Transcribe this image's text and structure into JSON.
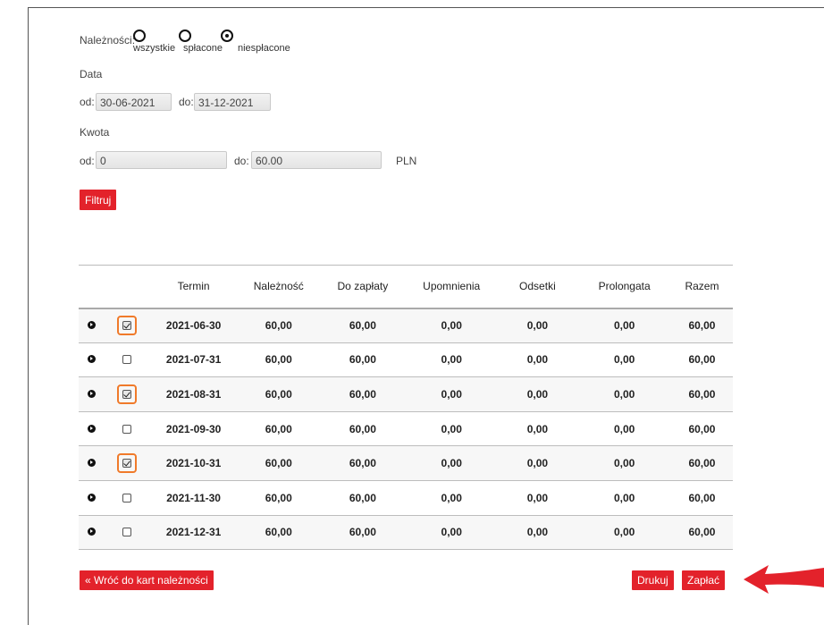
{
  "filters": {
    "dues_label": "Należności:",
    "radio_options": [
      {
        "label": "wszystkie",
        "checked": false
      },
      {
        "label": "spłacone",
        "checked": false
      },
      {
        "label": "niespłacone",
        "checked": true
      }
    ],
    "date_label": "Data",
    "date_from_label": "od:",
    "date_from_value": "30-06-2021",
    "date_to_label": "do:",
    "date_to_value": "31-12-2021",
    "amount_label": "Kwota",
    "amount_from_label": "od:",
    "amount_from_value": "0",
    "amount_to_label": "do:",
    "amount_to_value": "60.00",
    "currency": "PLN",
    "filter_button": "Filtruj"
  },
  "table": {
    "columns": [
      "",
      "",
      "Termin",
      "Należność",
      "Do zapłaty",
      "Upomnienia",
      "Odsetki",
      "Prolongata",
      "Razem"
    ],
    "rows": [
      {
        "checked": true,
        "cells": [
          "2021-06-30",
          "60,00",
          "60,00",
          "0,00",
          "0,00",
          "0,00",
          "60,00"
        ]
      },
      {
        "checked": false,
        "cells": [
          "2021-07-31",
          "60,00",
          "60,00",
          "0,00",
          "0,00",
          "0,00",
          "60,00"
        ]
      },
      {
        "checked": true,
        "cells": [
          "2021-08-31",
          "60,00",
          "60,00",
          "0,00",
          "0,00",
          "0,00",
          "60,00"
        ]
      },
      {
        "checked": false,
        "cells": [
          "2021-09-30",
          "60,00",
          "60,00",
          "0,00",
          "0,00",
          "0,00",
          "60,00"
        ]
      },
      {
        "checked": true,
        "cells": [
          "2021-10-31",
          "60,00",
          "60,00",
          "0,00",
          "0,00",
          "0,00",
          "60,00"
        ]
      },
      {
        "checked": false,
        "cells": [
          "2021-11-30",
          "60,00",
          "60,00",
          "0,00",
          "0,00",
          "0,00",
          "60,00"
        ]
      },
      {
        "checked": false,
        "cells": [
          "2021-12-31",
          "60,00",
          "60,00",
          "0,00",
          "0,00",
          "0,00",
          "60,00"
        ]
      }
    ]
  },
  "actions": {
    "back_button": "« Wróć do kart należności",
    "print_button": "Drukuj",
    "pay_button": "Zapłać"
  },
  "colors": {
    "accent": "#e3222b",
    "highlight": "#f07a2a"
  },
  "icons": {
    "row_expand": "expand-icon",
    "annotation": "red-arrow-icon"
  }
}
